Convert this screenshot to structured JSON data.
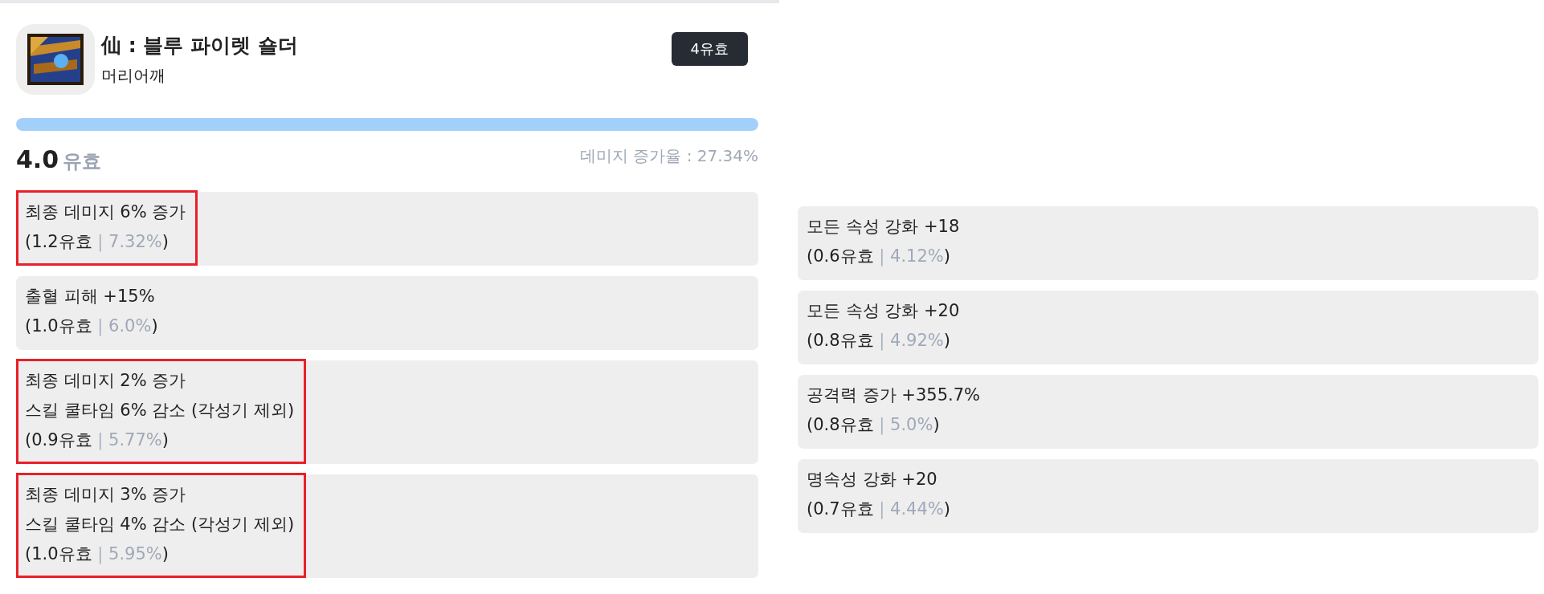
{
  "item": {
    "title": "仙 : 블루 파이렛 숄더",
    "slot": "머리어깨",
    "badge": "4유효"
  },
  "progress": {
    "level": 1.0
  },
  "summary": {
    "score": "4.0",
    "unit": "유효",
    "damage_increase": "데미지 증가율 : 27.34%"
  },
  "options_left": [
    {
      "lines": [
        "최종 데미지 6% 증가"
      ],
      "value": "(1.2유효",
      "separator": "|",
      "percent": "7.32%",
      "close": ")",
      "highlighted": true
    },
    {
      "lines": [
        "출혈 피해 +15%"
      ],
      "value": "(1.0유효",
      "separator": "|",
      "percent": "6.0%",
      "close": ")",
      "highlighted": false
    },
    {
      "lines": [
        "최종 데미지 2% 증가",
        "스킬 쿨타임 6% 감소 (각성기 제외)"
      ],
      "value": "(0.9유효",
      "separator": "|",
      "percent": "5.77%",
      "close": ")",
      "highlighted": true
    },
    {
      "lines": [
        "최종 데미지 3% 증가",
        "스킬 쿨타임 4% 감소 (각성기 제외)"
      ],
      "value": "(1.0유효",
      "separator": "|",
      "percent": "5.95%",
      "close": ")",
      "highlighted": true
    }
  ],
  "options_right": [
    {
      "lines": [
        "모든 속성 강화 +18"
      ],
      "value": "(0.6유효",
      "separator": "|",
      "percent": "4.12%",
      "close": ")",
      "highlighted": false
    },
    {
      "lines": [
        "모든 속성 강화 +20"
      ],
      "value": "(0.8유효",
      "separator": "|",
      "percent": "4.92%",
      "close": ")",
      "highlighted": false
    },
    {
      "lines": [
        "공격력 증가 +355.7%"
      ],
      "value": "(0.8유효",
      "separator": "|",
      "percent": "5.0%",
      "close": ")",
      "highlighted": false
    },
    {
      "lines": [
        "명속성 강화 +20"
      ],
      "value": "(0.7유효",
      "separator": "|",
      "percent": "4.44%",
      "close": ")",
      "highlighted": false
    }
  ]
}
